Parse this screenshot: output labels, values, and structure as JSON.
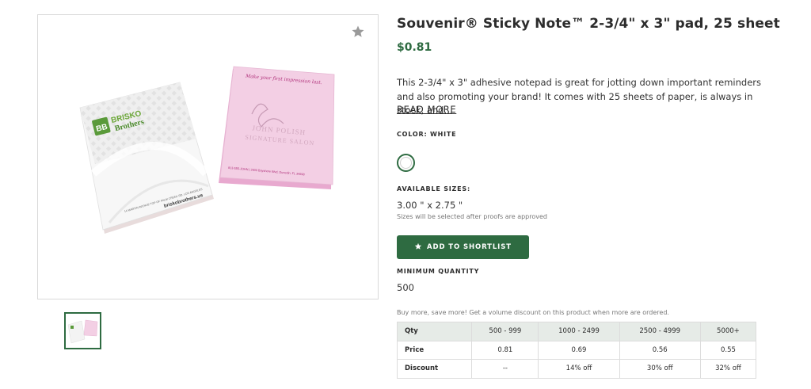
{
  "product": {
    "title": "Souvenir® Sticky Note™ 2-3/4\" x 3\" pad, 25 sheet",
    "price": "$0.81",
    "description": "This 2-3/4\" x 3\" adhesive notepad is great for jotting down important reminders and also promoting your brand! It comes with 25 sheets of paper, is always in stock, and...",
    "read_more": "READ MORE",
    "color_label": "COLOR: WHITE",
    "sizes_label": "AVAILABLE SIZES:",
    "size_value": "3.00 \" x 2.75 \"",
    "size_note": "Sizes will be selected after proofs are approved",
    "shortlist_label": "ADD TO SHORTLIST",
    "min_qty_label": "MINIMUM QUANTITY",
    "min_qty_value": "500",
    "volume_note": "Buy more, save more! Get a volume discount on this product when more are ordered."
  },
  "image_text": {
    "white_brand": "BRISKO",
    "white_brand2": "Brothers",
    "white_logo": "BB",
    "white_url": "briskobrothers.us",
    "white_small": "14 MARTIN AVENUE TOP OF PALM CREEK RD, LOS ANGELES",
    "pink_tagline": "Make your first impression last.",
    "pink_name": "JOHN POLISH",
    "pink_company": "SIGNATURE SALON",
    "pink_contact": "813-555-JOHN  |  2600 Bayshore Blvd, Dunedin, FL 34698"
  },
  "pricing": {
    "headers": [
      "Qty",
      "500 - 999",
      "1000 - 2499",
      "2500 - 4999",
      "5000+"
    ],
    "rows": [
      {
        "label": "Price",
        "values": [
          "0.81",
          "0.69",
          "0.56",
          "0.55"
        ]
      },
      {
        "label": "Discount",
        "values": [
          "--",
          "14% off",
          "30% off",
          "32% off"
        ]
      }
    ]
  },
  "colors": {
    "accent": "#2e6b41",
    "table_header": "#e6ebe7",
    "pink_pad": "#f0cbe2",
    "white_pad": "#f2f2f2"
  },
  "icons": {
    "favorite": "star-icon",
    "button": "star-icon"
  }
}
